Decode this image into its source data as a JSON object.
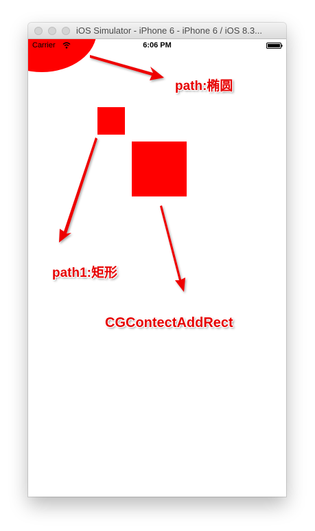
{
  "window": {
    "title": "iOS Simulator - iPhone 6 - iPhone 6 / iOS 8.3..."
  },
  "status_bar": {
    "carrier": "Carrier",
    "time": "6:06 PM",
    "wifi_icon": "wifi-icon",
    "battery_icon": "battery-icon"
  },
  "annotations": {
    "ellipse_label": "path:椭圆",
    "path1_label": "path1:矩形",
    "rect_label": "CGContectAddRect"
  },
  "colors": {
    "fill": "#ff0000",
    "annotation": "#e60000",
    "arrow": "#ee0000"
  }
}
